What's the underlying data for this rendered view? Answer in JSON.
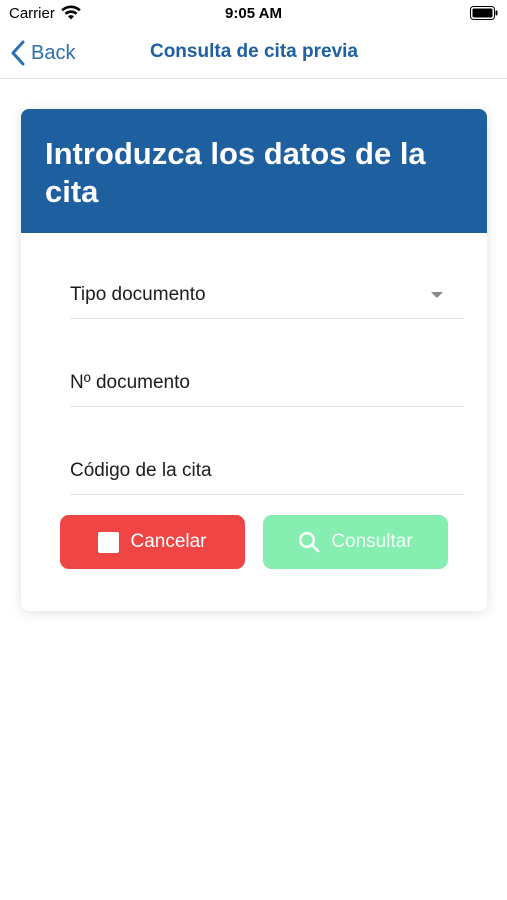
{
  "status_bar": {
    "carrier": "Carrier",
    "time": "9:05 AM"
  },
  "nav": {
    "back_label": "Back",
    "title": "Consulta de cita previa"
  },
  "form": {
    "header_title": "Introduzca los datos de la cita",
    "fields": [
      {
        "label": "Tipo documento",
        "type": "dropdown"
      },
      {
        "label": "Nº documento",
        "type": "text"
      },
      {
        "label": "Código de la cita",
        "type": "text"
      }
    ],
    "cancel_label": "Cancelar",
    "consult_label": "Consultar"
  },
  "colors": {
    "header_blue": "#1e5fa0",
    "nav_blue": "#1f5fa3",
    "cancel_red": "#f04545",
    "consult_green": "#86eeb0"
  },
  "icons": [
    "wifi-icon",
    "battery-icon",
    "chevron-left-icon",
    "dropdown-arrow-icon",
    "stop-icon",
    "search-icon"
  ]
}
